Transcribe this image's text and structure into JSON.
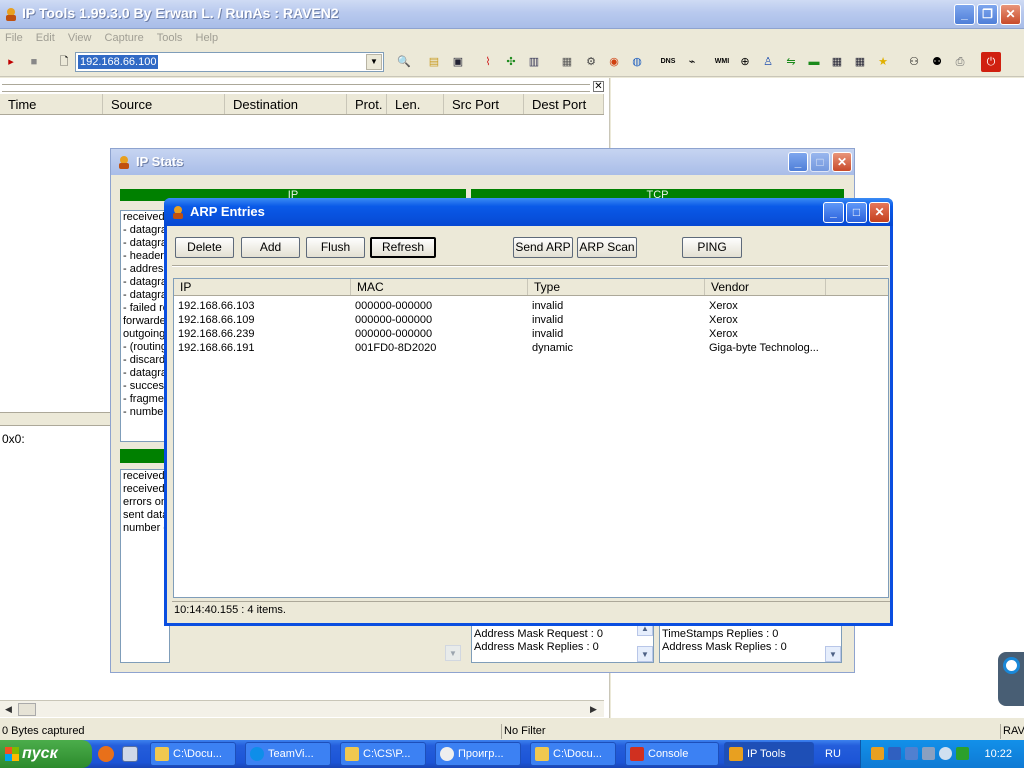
{
  "window": {
    "title": "IP Tools 1.99.3.0 By Erwan L. / RunAs : RAVEN2"
  },
  "menu": [
    "File",
    "Edit",
    "View",
    "Capture",
    "Tools",
    "Help"
  ],
  "toolbar": {
    "address_value": "192.168.66.100",
    "dns_label": "DNS",
    "wmi_label": "WMI"
  },
  "capture_list": {
    "columns": [
      "Time",
      "Source",
      "Destination",
      "Prot.",
      "Len.",
      "Src Port",
      "Dest Port"
    ],
    "hex_line": "0x0:"
  },
  "statusbar": {
    "captured": "0 Bytes captured",
    "filter": "No Filter",
    "user": "RAV"
  },
  "ip_stats": {
    "title": "IP Stats",
    "ip_header": "IP",
    "tcp_header": "TCP",
    "ip_lines": [
      "received",
      "- datagra",
      "- datagra",
      "- header",
      "- address",
      "- datagra",
      "- datagra",
      "- failed re",
      "forwarde",
      "outgoing",
      "- (routing",
      "- discard",
      "- datagra",
      "- succes",
      "- fragmen",
      "- number"
    ],
    "icmp_lines": [
      "received",
      "received",
      "errors on",
      "sent data",
      "number o"
    ],
    "icmp_in_tail": [
      "Address Mask Request : 0",
      "Address Mask Replies : 0"
    ],
    "icmp_out_tail": [
      "TimeStamps Replies : 0",
      "Address Mask Replies : 0"
    ]
  },
  "arp": {
    "title": "ARP Entries",
    "buttons": {
      "delete": "Delete",
      "add": "Add",
      "flush": "Flush",
      "refresh": "Refresh",
      "send_arp": "Send ARP",
      "arp_scan": "ARP Scan",
      "ping": "PING"
    },
    "columns": [
      "IP",
      "MAC",
      "Type",
      "Vendor"
    ],
    "rows": [
      {
        "ip": "192.168.66.103",
        "mac": "000000-000000",
        "type": "invalid",
        "vendor": "Xerox"
      },
      {
        "ip": "192.168.66.109",
        "mac": "000000-000000",
        "type": "invalid",
        "vendor": "Xerox"
      },
      {
        "ip": "192.168.66.239",
        "mac": "000000-000000",
        "type": "invalid",
        "vendor": "Xerox"
      },
      {
        "ip": "192.168.66.191",
        "mac": "001FD0-8D2020",
        "type": "dynamic",
        "vendor": "Giga-byte Technolog..."
      }
    ],
    "status": "10:14:40.155 : 4 items."
  },
  "taskbar": {
    "start_label": "пуск",
    "tasks": [
      "C:\\Docu...",
      "TeamVi...",
      "C:\\CS\\P...",
      "Проигр...",
      "C:\\Docu...",
      "Console",
      "IP Tools"
    ],
    "language": "RU",
    "clock": "10:22"
  },
  "colors": {
    "accent": "#0a5ae8",
    "stats_header": "#008000",
    "taskbar": "#245edb",
    "start": "#3c9a3c"
  }
}
